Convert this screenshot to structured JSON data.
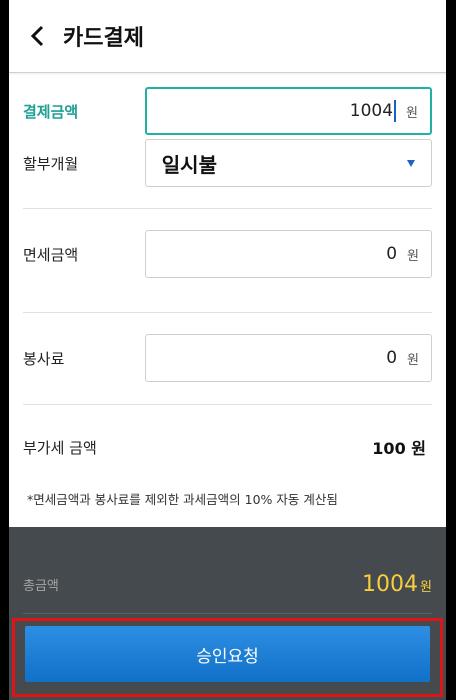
{
  "header": {
    "title": "카드결제",
    "back_icon": "chevron-left-icon"
  },
  "form": {
    "amount_label": "결제금액",
    "amount_value": "1004",
    "installment_label": "할부개월",
    "installment_value": "일시불",
    "tax_free_label": "면세금액",
    "tax_free_value": "0",
    "service_fee_label": "봉사료",
    "service_fee_value": "0",
    "vat_label": "부가세 금액",
    "vat_value": "100 원",
    "note": "*면세금액과 봉사료를 제외한 과세금액의 10% 자동 계산됨",
    "unit": "원"
  },
  "footer": {
    "total_label": "총금액",
    "total_value": "1004",
    "total_unit": "원",
    "approve_label": "승인요청"
  },
  "colors": {
    "accent": "#22b0a2",
    "button": "#1a7fd8",
    "highlight": "#e01414",
    "total": "#f7cf3d"
  }
}
